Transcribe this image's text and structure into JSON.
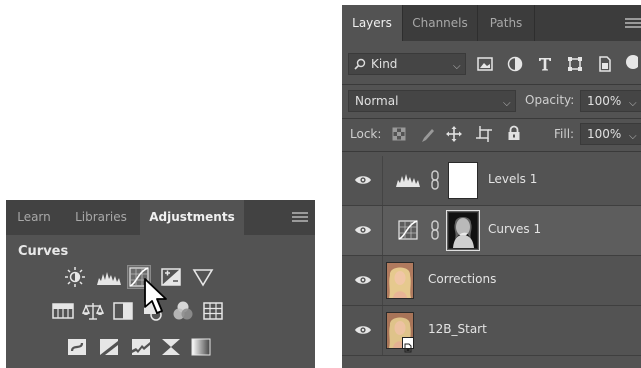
{
  "adjustments_panel": {
    "tabs": [
      {
        "label": "Learn",
        "active": false
      },
      {
        "label": "Libraries",
        "active": false
      },
      {
        "label": "Adjustments",
        "active": true
      }
    ],
    "section_title": "Curves",
    "icon_rows": [
      [
        "brightness-contrast-icon",
        "levels-icon",
        "curves-icon",
        "exposure-icon",
        "vibrance-icon"
      ],
      [
        "hue-saturation-icon",
        "color-balance-icon",
        "black-white-icon",
        "photo-filter-icon",
        "channel-mixer-icon",
        "color-lookup-icon"
      ],
      [
        "invert-icon",
        "posterize-icon",
        "threshold-icon",
        "selective-color-icon",
        "gradient-map-icon"
      ]
    ],
    "highlighted_icon": "curves-icon"
  },
  "layers_panel": {
    "tabs": [
      {
        "label": "Layers",
        "active": true
      },
      {
        "label": "Channels",
        "active": false
      },
      {
        "label": "Paths",
        "active": false
      }
    ],
    "filter": {
      "label": "Kind",
      "icons": [
        "pixel-filter-icon",
        "adjustment-filter-icon",
        "type-filter-icon",
        "shape-filter-icon",
        "smart-object-filter-icon",
        "toggle-filter-icon"
      ]
    },
    "blend_mode": "Normal",
    "opacity": {
      "label": "Opacity:",
      "value": "100%"
    },
    "lock": {
      "label": "Lock:",
      "icons": [
        "lock-transparent-icon",
        "lock-image-icon",
        "lock-position-icon",
        "lock-artboard-icon",
        "lock-all-icon"
      ]
    },
    "fill": {
      "label": "Fill:",
      "value": "100%"
    },
    "layers": [
      {
        "name": "Levels 1",
        "kind": "adjustment",
        "adjustment_icon": "levels-icon",
        "mask": "white",
        "selected": false,
        "visible": true
      },
      {
        "name": "Curves 1",
        "kind": "adjustment",
        "adjustment_icon": "curves-icon",
        "mask": "photo-silhouette",
        "selected": true,
        "visible": true
      },
      {
        "name": "Corrections",
        "kind": "pixel",
        "selected": false,
        "visible": true
      },
      {
        "name": "12B_Start",
        "kind": "smart-object",
        "selected": false,
        "visible": true
      }
    ]
  }
}
